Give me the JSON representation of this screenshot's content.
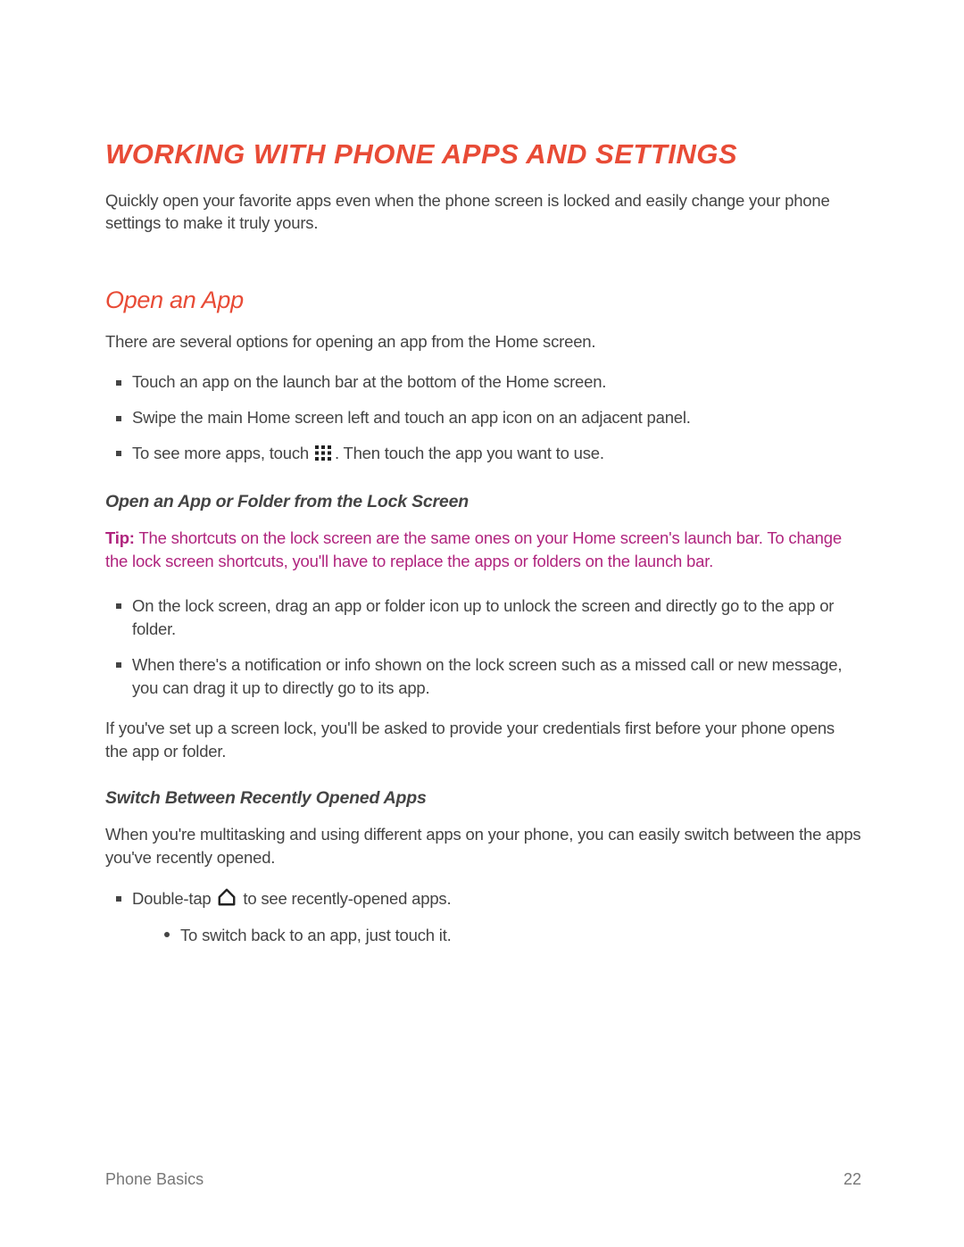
{
  "title": "WORKING WITH PHONE APPS AND SETTINGS",
  "intro": "Quickly open your favorite apps even when the phone screen is locked and easily change your phone settings to make it truly yours.",
  "section1": {
    "heading": "Open an App",
    "lead": "There are several options for opening an app from the Home screen.",
    "bullets": {
      "b1": "Touch an app on the launch bar at the bottom of the Home screen.",
      "b2": "Swipe the main Home screen left and touch an app icon on an adjacent panel.",
      "b3_pre": "To see more apps, touch ",
      "b3_post": ". Then touch the app you want to use."
    }
  },
  "sub1": {
    "heading": "Open an App or Folder from the Lock Screen",
    "tip_label": "Tip:",
    "tip_body": "  The shortcuts on the lock screen are the same ones on your Home screen's launch bar. To change the lock screen shortcuts, you'll have to replace the apps or folders on the launch bar.",
    "bullets": {
      "b1": "On the lock screen, drag an app or folder icon up to unlock the screen and directly go to the app or folder.",
      "b2": "When there's a notification or info shown on the lock screen such as a missed call or new message, you can drag it up to directly go to its app."
    },
    "after": "If you've set up a screen lock, you'll be asked to provide your credentials first before your phone opens the app or folder."
  },
  "sub2": {
    "heading": "Switch Between Recently Opened Apps",
    "lead": "When you're multitasking and using different apps on your phone, you can easily switch between the apps you've recently opened.",
    "b1_pre": "Double-tap ",
    "b1_post": " to see recently-opened apps.",
    "r1": "To switch back to an app, just touch it."
  },
  "footer": {
    "section": "Phone Basics",
    "page": "22"
  }
}
